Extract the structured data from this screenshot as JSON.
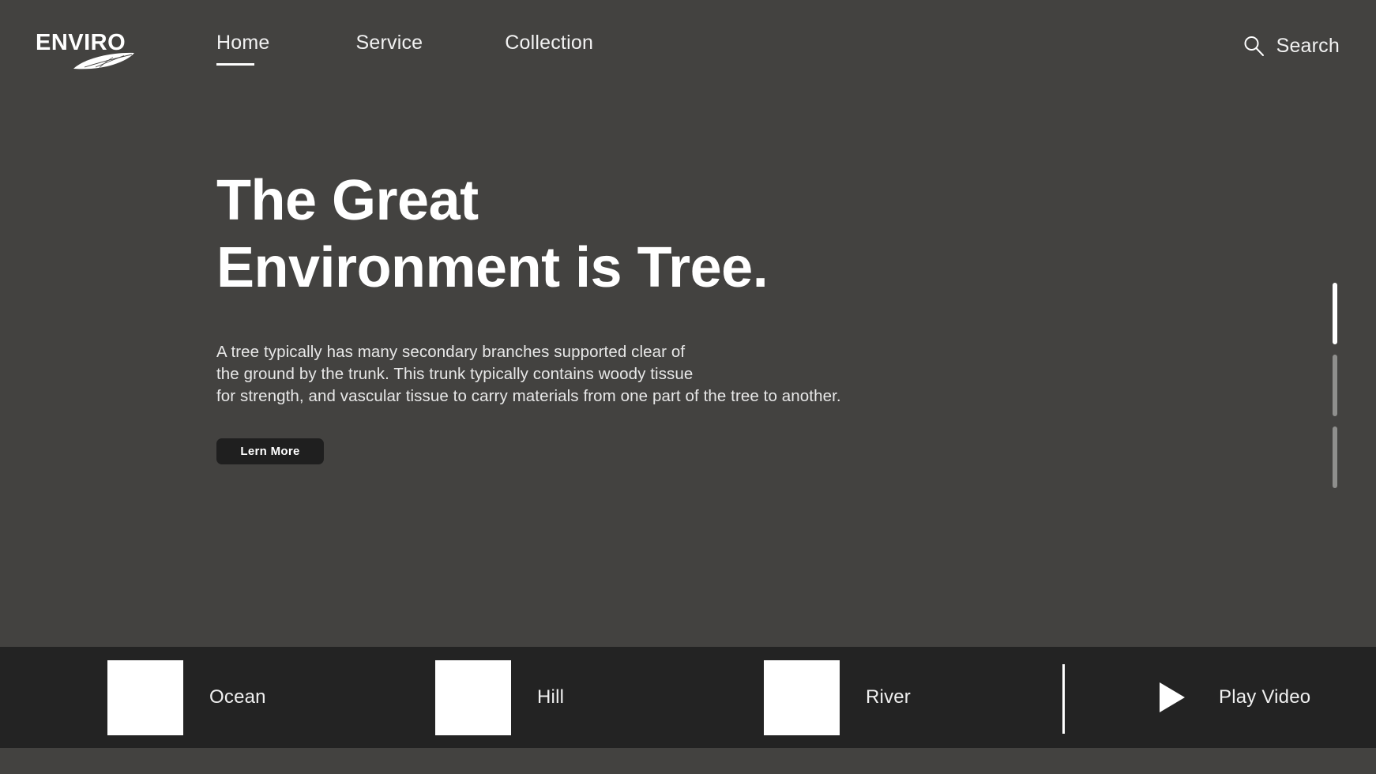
{
  "theme": {
    "background": "#434240",
    "bottom_bar_background": "#232323",
    "text": "#ffffff",
    "button_background": "#1f1f1f",
    "indicator_active": "#ffffff",
    "indicator_inactive": "#8f8f8d"
  },
  "header": {
    "logo": {
      "text": "ENVIRO",
      "icon": "leaf-icon"
    },
    "nav": [
      {
        "label": "Home",
        "active": true
      },
      {
        "label": "Service",
        "active": false
      },
      {
        "label": "Collection",
        "active": false
      }
    ],
    "search": {
      "label": "Search",
      "icon": "search-icon"
    }
  },
  "hero": {
    "title_line1": "The Great",
    "title_line2": "Environment is Tree.",
    "description_line1": "A tree typically has many secondary branches supported clear of",
    "description_line2": "the ground by the trunk. This trunk typically contains woody tissue",
    "description_line3": "for strength, and vascular tissue to carry materials from one part of the tree to another.",
    "cta_label": "Lern More"
  },
  "slide_indicators": [
    {
      "index": 1,
      "active": true
    },
    {
      "index": 2,
      "active": false
    },
    {
      "index": 3,
      "active": false
    }
  ],
  "bottom_bar": {
    "thumbnails": [
      {
        "label": "Ocean"
      },
      {
        "label": "Hill"
      },
      {
        "label": "River"
      }
    ],
    "play": {
      "label": "Play Video",
      "icon": "play-triangle-icon"
    }
  }
}
